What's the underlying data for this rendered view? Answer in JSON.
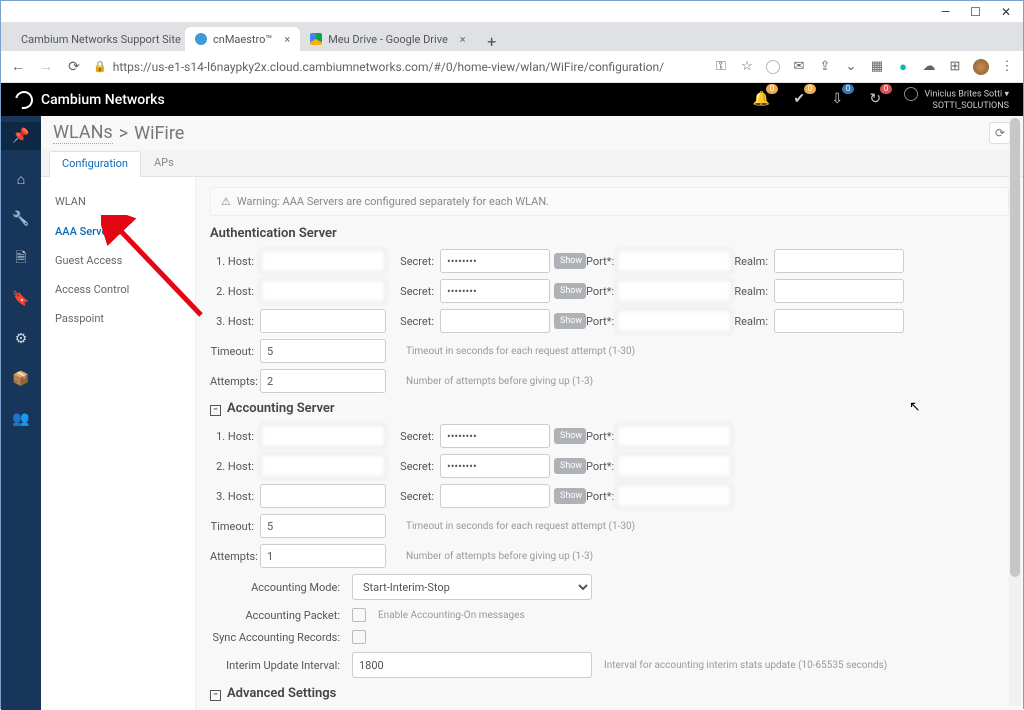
{
  "window": {
    "min": "—",
    "max": "☐",
    "close": "✕"
  },
  "browser": {
    "tabs": [
      {
        "title": "Cambium Networks Support Site",
        "active": false
      },
      {
        "title": "cnMaestro™",
        "active": true
      },
      {
        "title": "Meu Drive - Google Drive",
        "active": false
      }
    ],
    "url": "https://us-e1-s14-l6naypky2x.cloud.cambiumnetworks.com/#/0/home-view/wlan/WiFire/configuration/"
  },
  "header": {
    "brand": "Cambium Networks",
    "notif": [
      {
        "name": "bell",
        "badge": "0",
        "cls": ""
      },
      {
        "name": "check",
        "badge": "0",
        "cls": ""
      },
      {
        "name": "download",
        "badge": "0",
        "cls": "blue"
      },
      {
        "name": "sync",
        "badge": "0",
        "cls": "red"
      }
    ],
    "user_line1": "Vinicius Brites Sotti",
    "user_line2": "SOTTI_SOLUTIONS"
  },
  "breadcrumb": {
    "root": "WLANs",
    "current": "WiFire"
  },
  "tabs": {
    "configuration": "Configuration",
    "aps": "APs"
  },
  "sidebar": {
    "wlan": "WLAN",
    "aaa": "AAA Servers",
    "guest": "Guest Access",
    "access": "Access Control",
    "passpoint": "Passpoint"
  },
  "alert": "Warning:  AAA Servers are configured separately for each WLAN.",
  "sections": {
    "auth_title": "Authentication Server",
    "acct_title": "Accounting Server",
    "adv_title": "Advanced Settings"
  },
  "labels": {
    "host1": "1. Host:",
    "host2": "2. Host:",
    "host3": "3. Host:",
    "secret": "Secret:",
    "port": "Port*:",
    "realm": "Realm:",
    "timeout": "Timeout:",
    "attempts": "Attempts:",
    "show": "Show",
    "timeout_help": "Timeout in seconds for each request attempt (1-30)",
    "attempts_help": "Number of attempts before giving up (1-3)",
    "acc_mode": "Accounting Mode:",
    "acc_packet": "Accounting Packet:",
    "sync": "Sync Accounting Records:",
    "interim": "Interim Update Interval:",
    "acc_packet_cb": "Enable Accounting-On messages",
    "interim_help": "Interval for accounting interim stats update (10-65535 seconds)"
  },
  "auth": {
    "rows": [
      {
        "host": "",
        "secret": "••••••••",
        "port": ""
      },
      {
        "host": "",
        "secret": "••••••••",
        "port": ""
      },
      {
        "host": "",
        "secret": "",
        "port": ""
      }
    ],
    "timeout": "5",
    "attempts": "2"
  },
  "acct": {
    "rows": [
      {
        "host": "",
        "secret": "••••••••",
        "port": ""
      },
      {
        "host": "",
        "secret": "••••••••",
        "port": ""
      },
      {
        "host": "",
        "secret": "",
        "port": ""
      }
    ],
    "timeout": "5",
    "attempts": "1",
    "mode": "Start-Interim-Stop",
    "interim": "1800"
  }
}
